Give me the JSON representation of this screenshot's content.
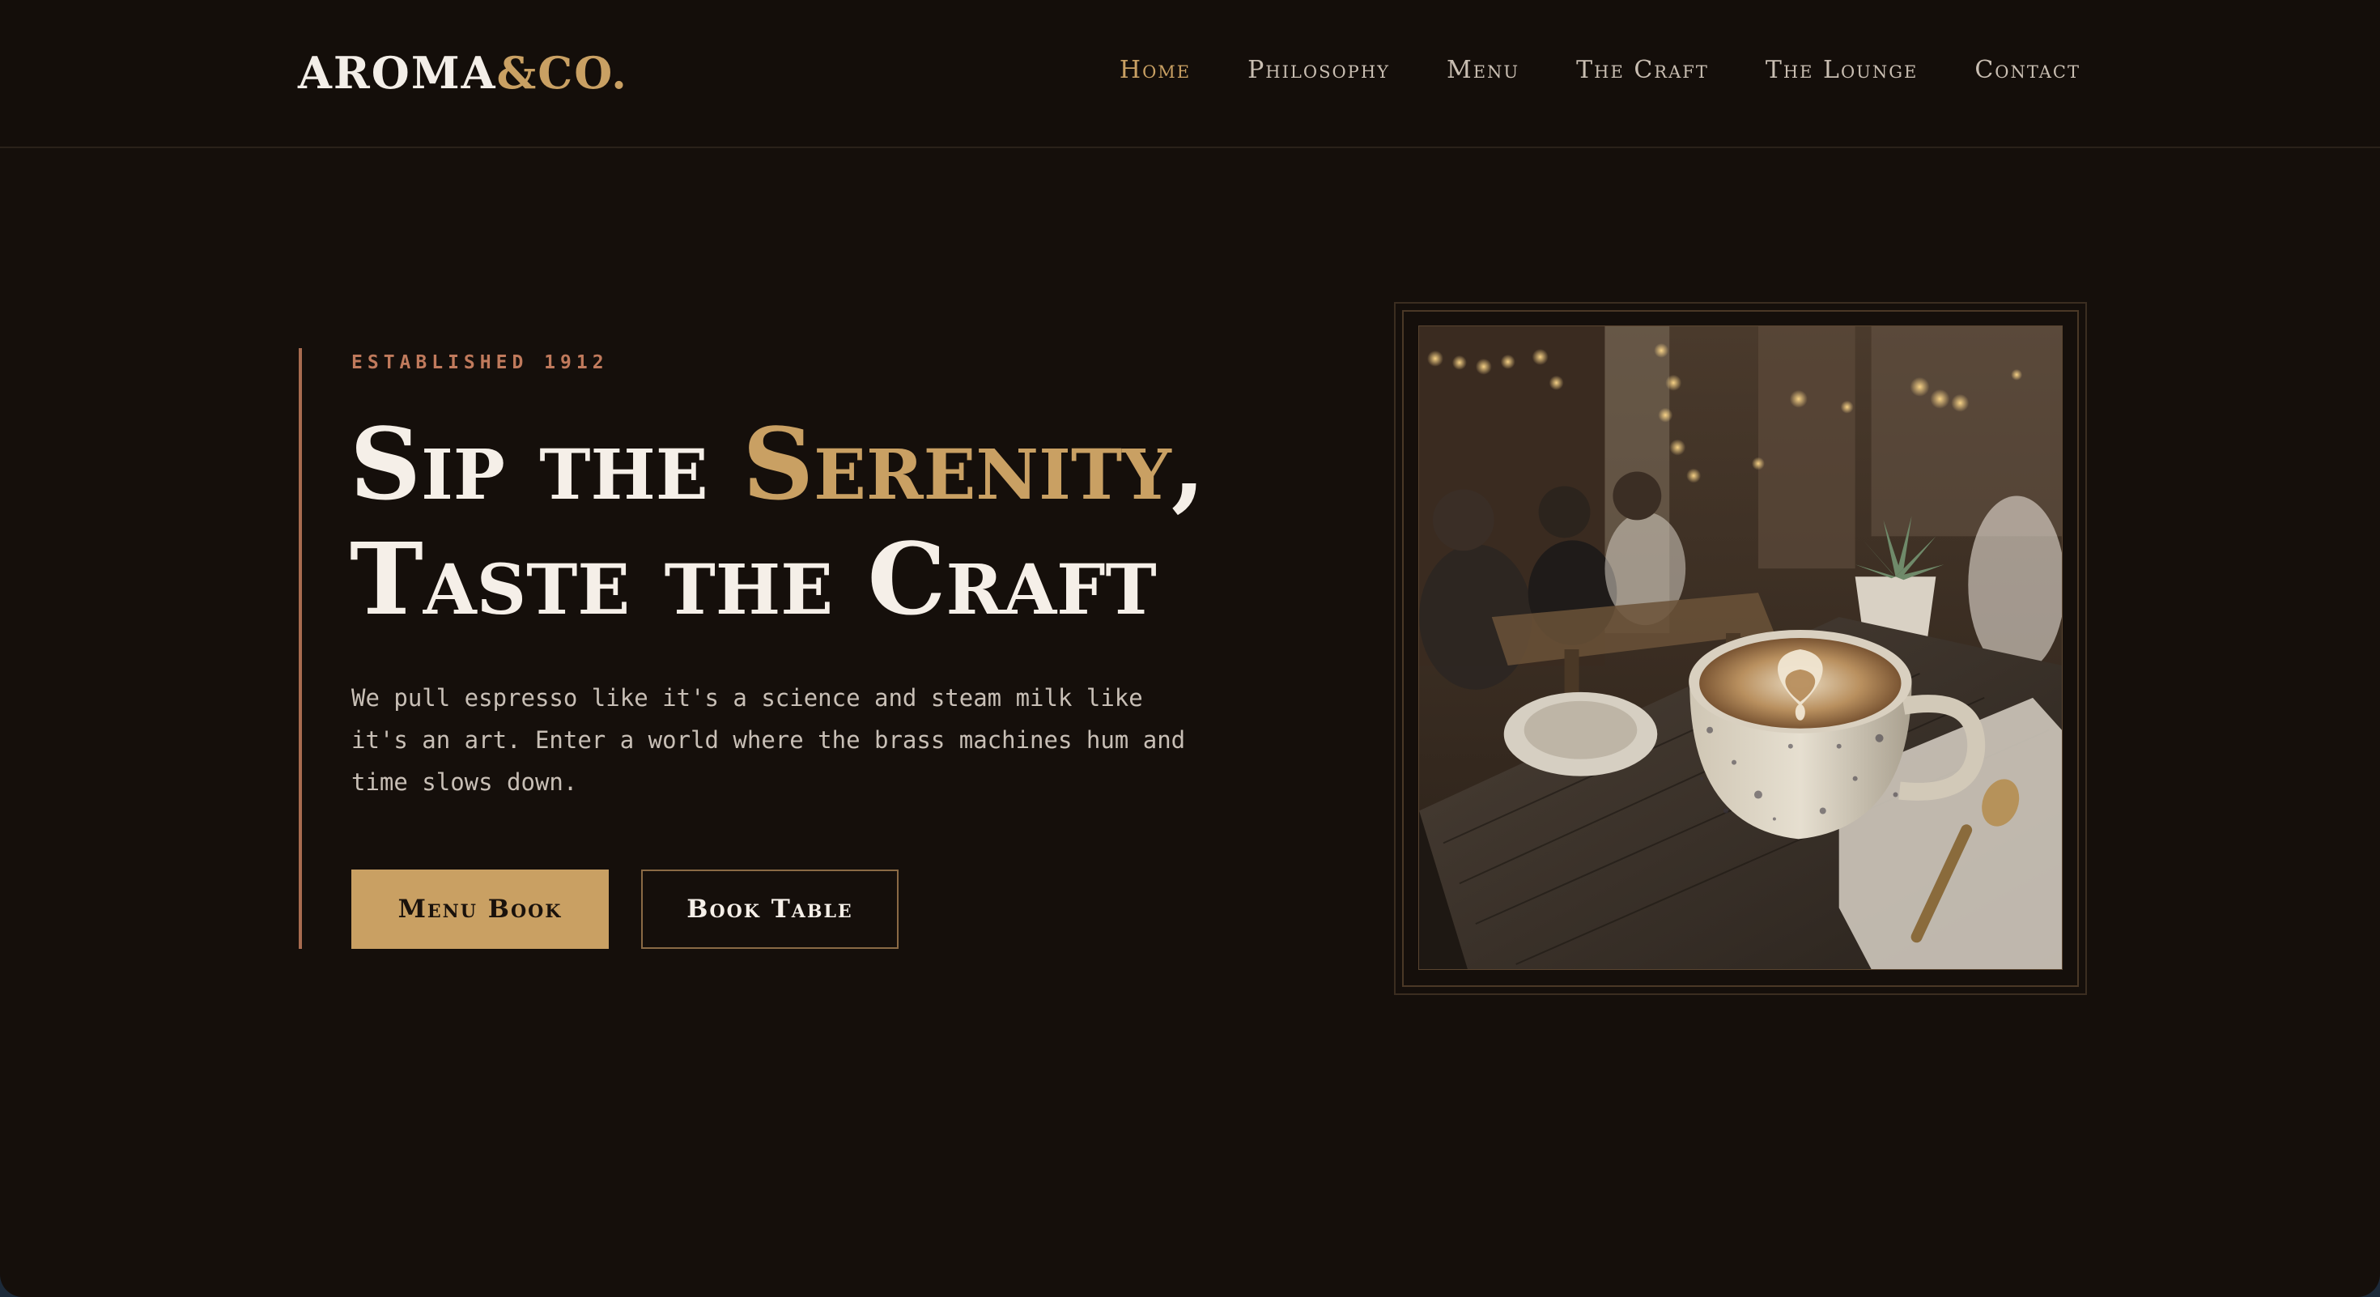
{
  "brand": {
    "name_main": "AROMA",
    "name_accent": "&CO."
  },
  "nav": {
    "items": [
      {
        "label": "Home",
        "active": true
      },
      {
        "label": "Philosophy",
        "active": false
      },
      {
        "label": "Menu",
        "active": false
      },
      {
        "label": "The Craft",
        "active": false
      },
      {
        "label": "The Lounge",
        "active": false
      },
      {
        "label": "Contact",
        "active": false
      }
    ]
  },
  "hero": {
    "eyebrow": "ESTABLISHED 1912",
    "headline_part1": "Sip the ",
    "headline_accent": "Serenity",
    "headline_part2": ",",
    "headline_line2": "Taste the Craft",
    "body": "We pull espresso like it's a science and steam milk like it's an art. Enter a world where the brass machines hum and time slows down.",
    "primary_button": "Menu Book",
    "secondary_button": "Book Table"
  },
  "colors": {
    "background": "#150f0b",
    "accent_gold": "#c9a063",
    "accent_copper": "#a86b50",
    "text_light": "#f5efe8"
  },
  "image": {
    "icon": "cafe-latte-photo"
  }
}
